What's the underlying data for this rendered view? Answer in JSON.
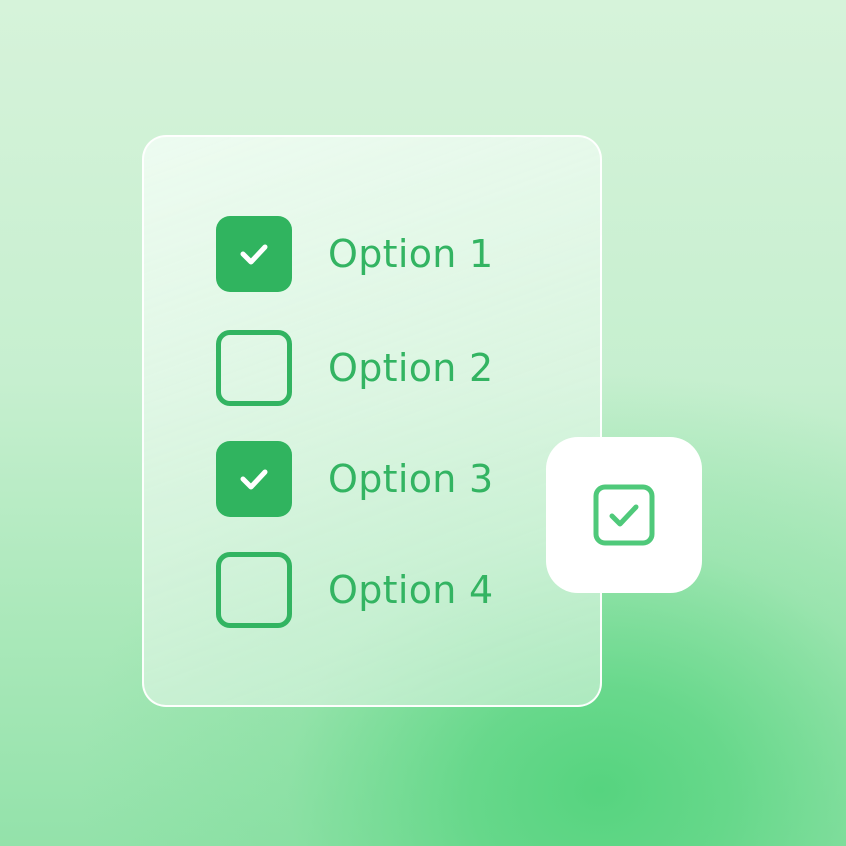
{
  "options": [
    {
      "label": "Option 1",
      "checked": true
    },
    {
      "label": "Option 2",
      "checked": false
    },
    {
      "label": "Option 3",
      "checked": true
    },
    {
      "label": "Option 4",
      "checked": false
    }
  ],
  "badge": {
    "icon": "checkbox-checked-icon"
  },
  "colors": {
    "accent": "#30b45f",
    "label": "#33b462",
    "card_border": "#ffffff",
    "badge_bg": "#ffffff"
  }
}
